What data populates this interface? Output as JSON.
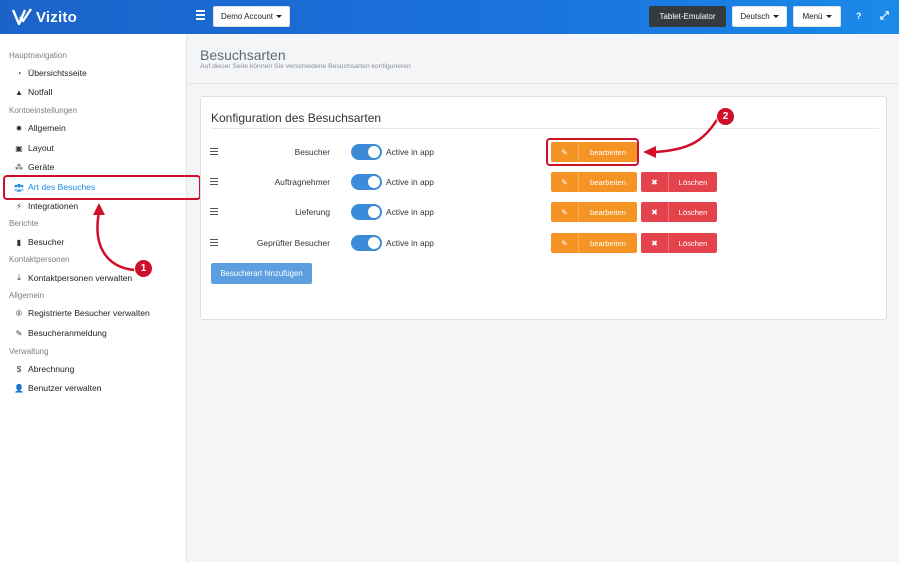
{
  "app": {
    "name": "Vizito"
  },
  "topbar": {
    "account_label": "Demo Account",
    "tablet_label": "Tablet-Emulator",
    "language_label": "Deutsch",
    "menu_label": "Menü",
    "help_symbol": "?",
    "expand_symbol": "⤢"
  },
  "sidebar": {
    "sections": [
      {
        "title": "Hauptnavigation",
        "items": [
          {
            "label": "Übersichtsseite",
            "icon": "gauge-icon"
          },
          {
            "label": "Notfall",
            "icon": "warning-icon"
          }
        ]
      },
      {
        "title": "Kontoeinstellungen",
        "items": [
          {
            "label": "Allgemein",
            "icon": "gear-icon"
          },
          {
            "label": "Layout",
            "icon": "image-icon"
          },
          {
            "label": "Geräte",
            "icon": "sitemap-icon"
          },
          {
            "label": "Art des Besuches",
            "icon": "users-icon",
            "active": true
          },
          {
            "label": "Integrationen",
            "icon": "plug-icon"
          }
        ]
      },
      {
        "title": "Berichte",
        "items": [
          {
            "label": "Besucher",
            "icon": "book-icon"
          }
        ]
      },
      {
        "title": "Kontaktpersonen",
        "items": [
          {
            "label": "Kontaktpersonen verwalten",
            "icon": "download-icon"
          }
        ]
      },
      {
        "title": "Allgemein",
        "items": [
          {
            "label": "Registrierte Besucher verwalten",
            "icon": "registered-icon"
          },
          {
            "label": "Besucheranmeldung",
            "icon": "pencil-icon"
          }
        ]
      },
      {
        "title": "Verwaltung",
        "items": [
          {
            "label": "Abrechnung",
            "icon": "dollar-icon"
          },
          {
            "label": "Benutzer verwalten",
            "icon": "user-plus-icon"
          }
        ]
      }
    ]
  },
  "page": {
    "title": "Besuchsarten",
    "subtitle": "Auf dieser Seite können Sie verschiedene Besuchsarten konfigurieren"
  },
  "card": {
    "title": "Konfiguration des Besuchsarten",
    "toggle_label": "Active in app",
    "edit_label": "bearbeiten",
    "delete_label": "Löschen",
    "add_label": "Besucherart hinzufügen",
    "rows": [
      {
        "name": "Besucher",
        "active": true,
        "deletable": false
      },
      {
        "name": "Auftragnehmer",
        "active": true,
        "deletable": true
      },
      {
        "name": "Lieferung",
        "active": true,
        "deletable": true
      },
      {
        "name": "Geprüfter Besucher",
        "active": true,
        "deletable": true
      }
    ]
  },
  "annotations": {
    "badge_1": "1",
    "badge_2": "2"
  },
  "colors": {
    "primary": "#1a73de",
    "edit": "#f59324",
    "delete": "#e5434b",
    "highlight": "#d0102b",
    "add": "#5b9fe0"
  }
}
